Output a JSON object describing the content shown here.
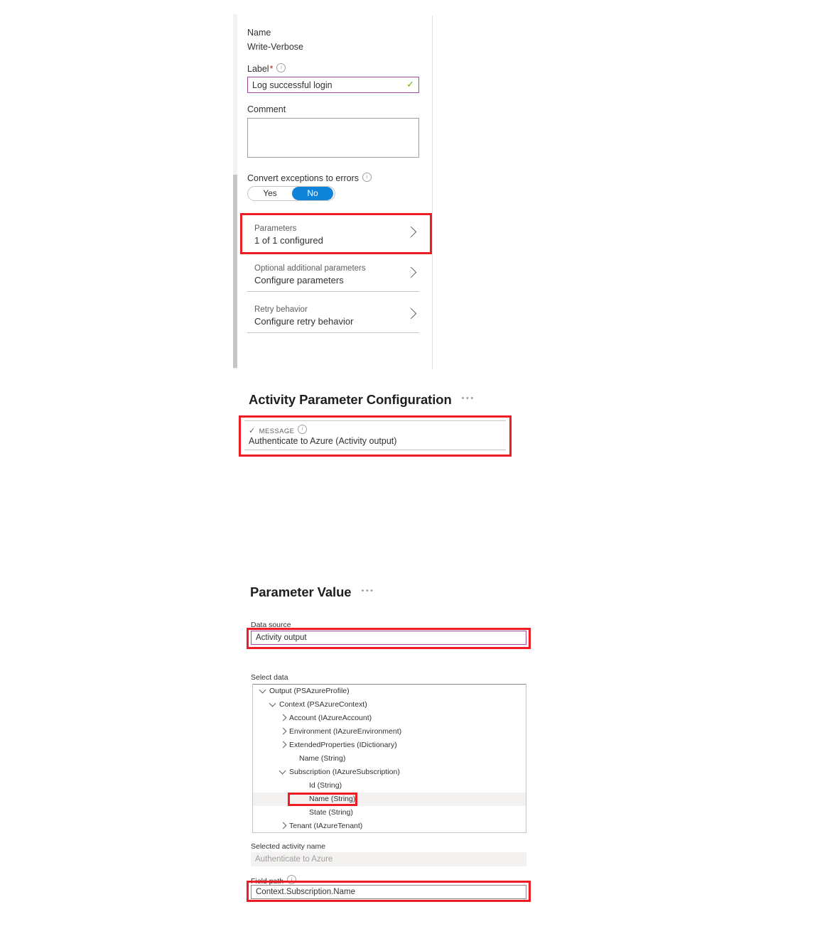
{
  "activity_panel": {
    "name_label": "Name",
    "name_value": "Write-Verbose",
    "label_label": "Label",
    "label_required_mark": "*",
    "label_value": "Log successful login",
    "label_valid_icon": "green-check-icon",
    "comment_label": "Comment",
    "comment_value": "",
    "convert_label": "Convert exceptions to errors",
    "toggle": {
      "yes": "Yes",
      "no": "No",
      "selected": "No",
      "selected_color": "#0f83d8"
    },
    "rows": [
      {
        "title": "Parameters",
        "subtitle": "1 of 1 configured"
      },
      {
        "title": "Optional additional parameters",
        "subtitle": "Configure parameters"
      },
      {
        "title": "Retry behavior",
        "subtitle": "Configure retry behavior"
      }
    ]
  },
  "activity_param_config": {
    "title": "Activity Parameter Configuration",
    "overflow_glyph": "•••",
    "param_name": "MESSAGE",
    "param_value": "Authenticate to Azure (Activity output)"
  },
  "parameter_value": {
    "title": "Parameter Value",
    "overflow_glyph": "•••",
    "data_source_label": "Data source",
    "data_source_value": "Activity output",
    "select_data_label": "Select data",
    "tree": [
      {
        "indent": 0,
        "state": "expanded",
        "text": "Output (PSAzureProfile)"
      },
      {
        "indent": 1,
        "state": "expanded",
        "text": "Context (PSAzureContext)"
      },
      {
        "indent": 2,
        "state": "collapsed",
        "text": "Account (IAzureAccount)"
      },
      {
        "indent": 2,
        "state": "collapsed",
        "text": "Environment (IAzureEnvironment)"
      },
      {
        "indent": 2,
        "state": "collapsed",
        "text": "ExtendedProperties (IDictionary)"
      },
      {
        "indent": 3,
        "state": "none",
        "text": "Name (String)"
      },
      {
        "indent": 2,
        "state": "expanded",
        "text": "Subscription (IAzureSubscription)"
      },
      {
        "indent": 4,
        "state": "none",
        "text": "Id (String)"
      },
      {
        "indent": 4,
        "state": "none",
        "text": "Name (String)",
        "selected": true
      },
      {
        "indent": 4,
        "state": "none",
        "text": "State (String)"
      },
      {
        "indent": 2,
        "state": "collapsed",
        "text": "Tenant (IAzureTenant)"
      }
    ],
    "selected_activity_label": "Selected activity name",
    "selected_activity_value": "Authenticate to Azure",
    "field_path_label": "Field path",
    "field_path_value": "Context.Subscription.Name"
  },
  "annotation": {
    "highlight_color": "#ee1c25"
  }
}
